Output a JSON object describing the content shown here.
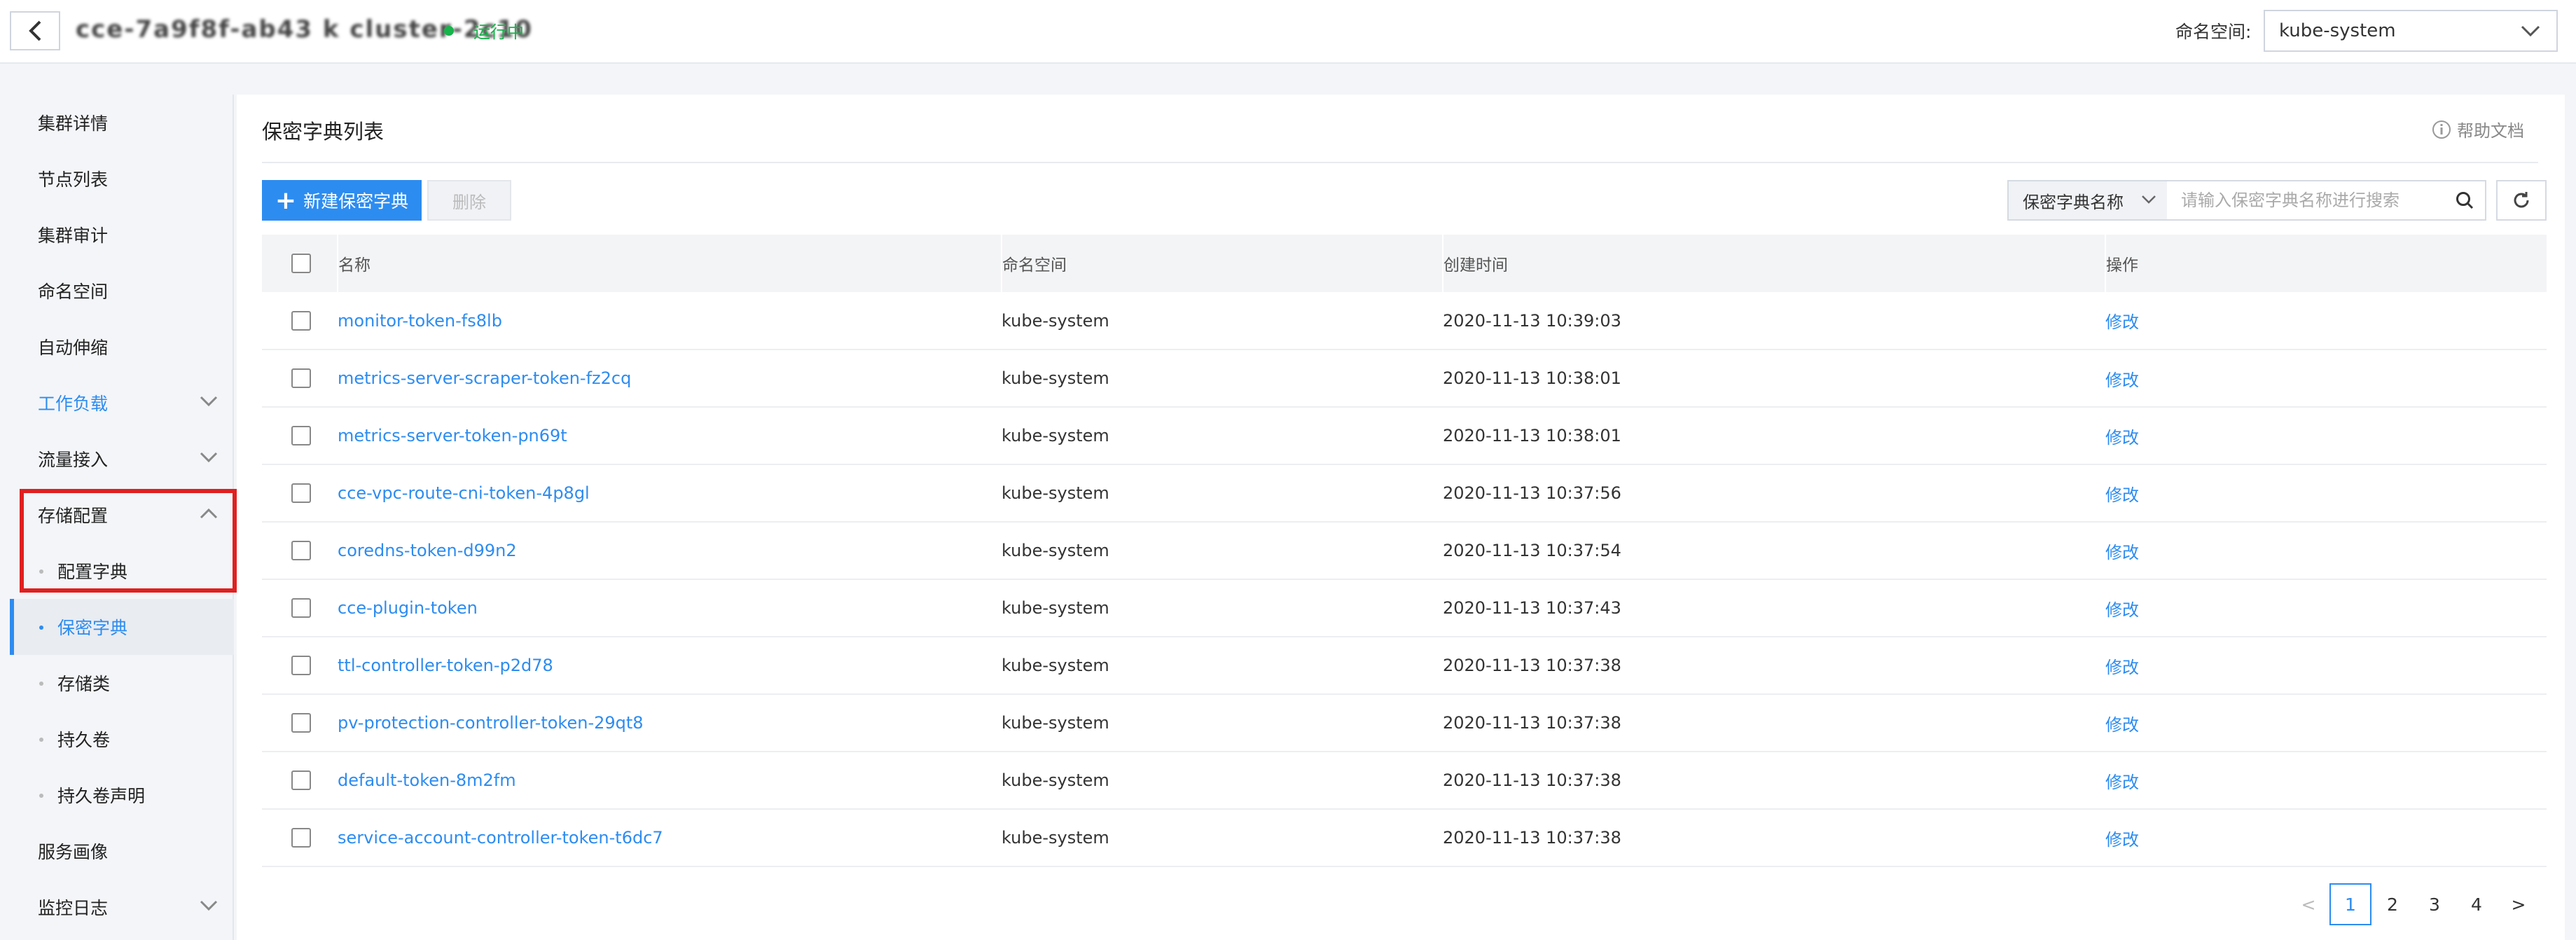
{
  "header": {
    "cluster_name": "cce-7a9f8f-ab43 k cluster-2c10",
    "status": "运行中",
    "namespace_label": "命名空间:",
    "namespace_value": "kube-system"
  },
  "sidebar": {
    "items": [
      {
        "label": "集群详情"
      },
      {
        "label": "节点列表"
      },
      {
        "label": "集群审计"
      },
      {
        "label": "命名空间"
      },
      {
        "label": "自动伸缩"
      },
      {
        "label": "工作负载"
      },
      {
        "label": "流量接入"
      },
      {
        "label": "存储配置"
      },
      {
        "label": "配置字典"
      },
      {
        "label": "保密字典"
      },
      {
        "label": "存储类"
      },
      {
        "label": "持久卷"
      },
      {
        "label": "持久卷声明"
      },
      {
        "label": "服务画像"
      },
      {
        "label": "监控日志"
      }
    ]
  },
  "main": {
    "title": "保密字典列表",
    "help": "帮助文档",
    "create_button": "新建保密字典",
    "delete_button": "删除",
    "search_type": "保密字典名称",
    "search_placeholder": "请输入保密字典名称进行搜索",
    "columns": [
      "名称",
      "命名空间",
      "创建时间",
      "操作"
    ],
    "rows": [
      {
        "name": "monitor-token-fs8lb",
        "namespace": "kube-system",
        "created": "2020-11-13 10:39:03",
        "action": "修改"
      },
      {
        "name": "metrics-server-scraper-token-fz2cq",
        "namespace": "kube-system",
        "created": "2020-11-13 10:38:01",
        "action": "修改"
      },
      {
        "name": "metrics-server-token-pn69t",
        "namespace": "kube-system",
        "created": "2020-11-13 10:38:01",
        "action": "修改"
      },
      {
        "name": "cce-vpc-route-cni-token-4p8gl",
        "namespace": "kube-system",
        "created": "2020-11-13 10:37:56",
        "action": "修改"
      },
      {
        "name": "coredns-token-d99n2",
        "namespace": "kube-system",
        "created": "2020-11-13 10:37:54",
        "action": "修改"
      },
      {
        "name": "cce-plugin-token",
        "namespace": "kube-system",
        "created": "2020-11-13 10:37:43",
        "action": "修改"
      },
      {
        "name": "ttl-controller-token-p2d78",
        "namespace": "kube-system",
        "created": "2020-11-13 10:37:38",
        "action": "修改"
      },
      {
        "name": "pv-protection-controller-token-29qt8",
        "namespace": "kube-system",
        "created": "2020-11-13 10:37:38",
        "action": "修改"
      },
      {
        "name": "default-token-8m2fm",
        "namespace": "kube-system",
        "created": "2020-11-13 10:37:38",
        "action": "修改"
      },
      {
        "name": "service-account-controller-token-t6dc7",
        "namespace": "kube-system",
        "created": "2020-11-13 10:37:38",
        "action": "修改"
      }
    ],
    "pagination": {
      "prev": "<",
      "pages": [
        "1",
        "2",
        "3",
        "4"
      ],
      "current": "1",
      "next": ">"
    }
  },
  "colors": {
    "accent": "#2d8cf0",
    "status_running": "#17b34b",
    "highlight": "#e02020"
  }
}
